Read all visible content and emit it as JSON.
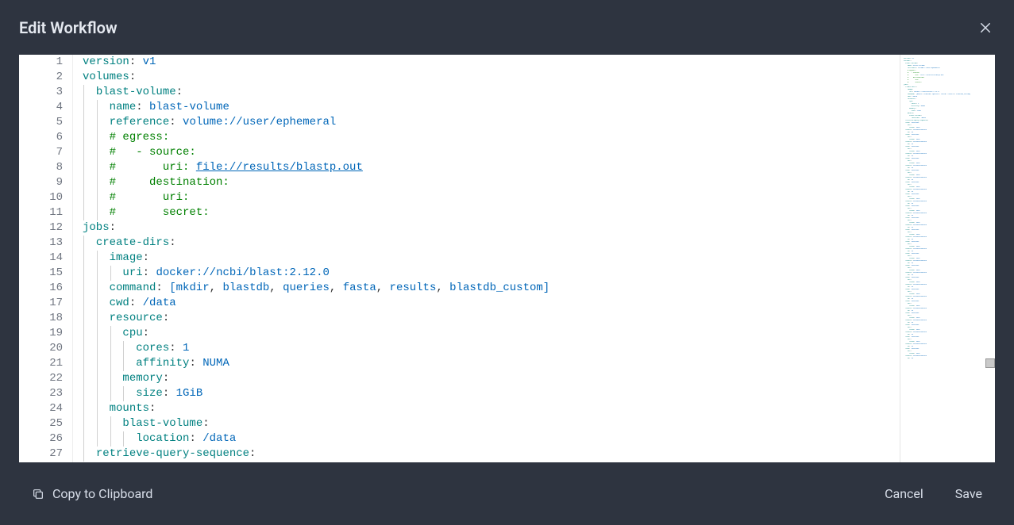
{
  "header": {
    "title": "Edit Workflow"
  },
  "editor": {
    "lines": [
      {
        "n": 1,
        "indent": 0,
        "tokens": [
          [
            "key",
            "version"
          ],
          [
            "punct",
            ": "
          ],
          [
            "val",
            "v1"
          ]
        ]
      },
      {
        "n": 2,
        "indent": 0,
        "tokens": [
          [
            "key",
            "volumes"
          ],
          [
            "punct",
            ":"
          ]
        ]
      },
      {
        "n": 3,
        "indent": 1,
        "tokens": [
          [
            "key",
            "blast-volume"
          ],
          [
            "punct",
            ":"
          ]
        ]
      },
      {
        "n": 4,
        "indent": 2,
        "tokens": [
          [
            "key",
            "name"
          ],
          [
            "punct",
            ": "
          ],
          [
            "val",
            "blast-volume"
          ]
        ]
      },
      {
        "n": 5,
        "indent": 2,
        "tokens": [
          [
            "key",
            "reference"
          ],
          [
            "punct",
            ": "
          ],
          [
            "val",
            "volume://user/ephemeral"
          ]
        ]
      },
      {
        "n": 6,
        "indent": 2,
        "tokens": [
          [
            "comment",
            "# egress:"
          ]
        ]
      },
      {
        "n": 7,
        "indent": 2,
        "tokens": [
          [
            "comment",
            "#   - source:"
          ]
        ]
      },
      {
        "n": 8,
        "indent": 2,
        "tokens": [
          [
            "comment",
            "#       uri: "
          ],
          [
            "link",
            "file://results/blastp.out"
          ]
        ]
      },
      {
        "n": 9,
        "indent": 2,
        "tokens": [
          [
            "comment",
            "#     destination:"
          ]
        ]
      },
      {
        "n": 10,
        "indent": 2,
        "tokens": [
          [
            "comment",
            "#       uri:"
          ]
        ]
      },
      {
        "n": 11,
        "indent": 2,
        "tokens": [
          [
            "comment",
            "#       secret:"
          ]
        ]
      },
      {
        "n": 12,
        "indent": 0,
        "tokens": [
          [
            "key",
            "jobs"
          ],
          [
            "punct",
            ":"
          ]
        ]
      },
      {
        "n": 13,
        "indent": 1,
        "tokens": [
          [
            "key",
            "create-dirs"
          ],
          [
            "punct",
            ":"
          ]
        ]
      },
      {
        "n": 14,
        "indent": 2,
        "tokens": [
          [
            "key",
            "image"
          ],
          [
            "punct",
            ":"
          ]
        ]
      },
      {
        "n": 15,
        "indent": 3,
        "tokens": [
          [
            "key",
            "uri"
          ],
          [
            "punct",
            ": "
          ],
          [
            "val",
            "docker://ncbi/blast:2.12.0"
          ]
        ]
      },
      {
        "n": 16,
        "indent": 2,
        "tokens": [
          [
            "key",
            "command"
          ],
          [
            "punct",
            ": "
          ],
          [
            "val",
            "[mkdir"
          ],
          [
            "punct",
            ", "
          ],
          [
            "val",
            "blastdb"
          ],
          [
            "punct",
            ", "
          ],
          [
            "val",
            "queries"
          ],
          [
            "punct",
            ", "
          ],
          [
            "val",
            "fasta"
          ],
          [
            "punct",
            ", "
          ],
          [
            "val",
            "results"
          ],
          [
            "punct",
            ", "
          ],
          [
            "val",
            "blastdb_custom]"
          ]
        ]
      },
      {
        "n": 17,
        "indent": 2,
        "tokens": [
          [
            "key",
            "cwd"
          ],
          [
            "punct",
            ": "
          ],
          [
            "val",
            "/data"
          ]
        ]
      },
      {
        "n": 18,
        "indent": 2,
        "tokens": [
          [
            "key",
            "resource"
          ],
          [
            "punct",
            ":"
          ]
        ]
      },
      {
        "n": 19,
        "indent": 3,
        "tokens": [
          [
            "key",
            "cpu"
          ],
          [
            "punct",
            ":"
          ]
        ]
      },
      {
        "n": 20,
        "indent": 4,
        "tokens": [
          [
            "key",
            "cores"
          ],
          [
            "punct",
            ": "
          ],
          [
            "val",
            "1"
          ]
        ]
      },
      {
        "n": 21,
        "indent": 4,
        "tokens": [
          [
            "key",
            "affinity"
          ],
          [
            "punct",
            ": "
          ],
          [
            "val",
            "NUMA"
          ]
        ]
      },
      {
        "n": 22,
        "indent": 3,
        "tokens": [
          [
            "key",
            "memory"
          ],
          [
            "punct",
            ":"
          ]
        ]
      },
      {
        "n": 23,
        "indent": 4,
        "tokens": [
          [
            "key",
            "size"
          ],
          [
            "punct",
            ": "
          ],
          [
            "val",
            "1GiB"
          ]
        ]
      },
      {
        "n": 24,
        "indent": 2,
        "tokens": [
          [
            "key",
            "mounts"
          ],
          [
            "punct",
            ":"
          ]
        ]
      },
      {
        "n": 25,
        "indent": 3,
        "tokens": [
          [
            "key",
            "blast-volume"
          ],
          [
            "punct",
            ":"
          ]
        ]
      },
      {
        "n": 26,
        "indent": 4,
        "tokens": [
          [
            "key",
            "location"
          ],
          [
            "punct",
            ": "
          ],
          [
            "val",
            "/data"
          ]
        ]
      },
      {
        "n": 27,
        "indent": 1,
        "tokens": [
          [
            "key",
            "retrieve-query-sequence"
          ],
          [
            "punct",
            ":"
          ]
        ]
      }
    ],
    "indentSize": 2
  },
  "footer": {
    "copy_label": "Copy to Clipboard",
    "cancel_label": "Cancel",
    "save_label": "Save"
  }
}
